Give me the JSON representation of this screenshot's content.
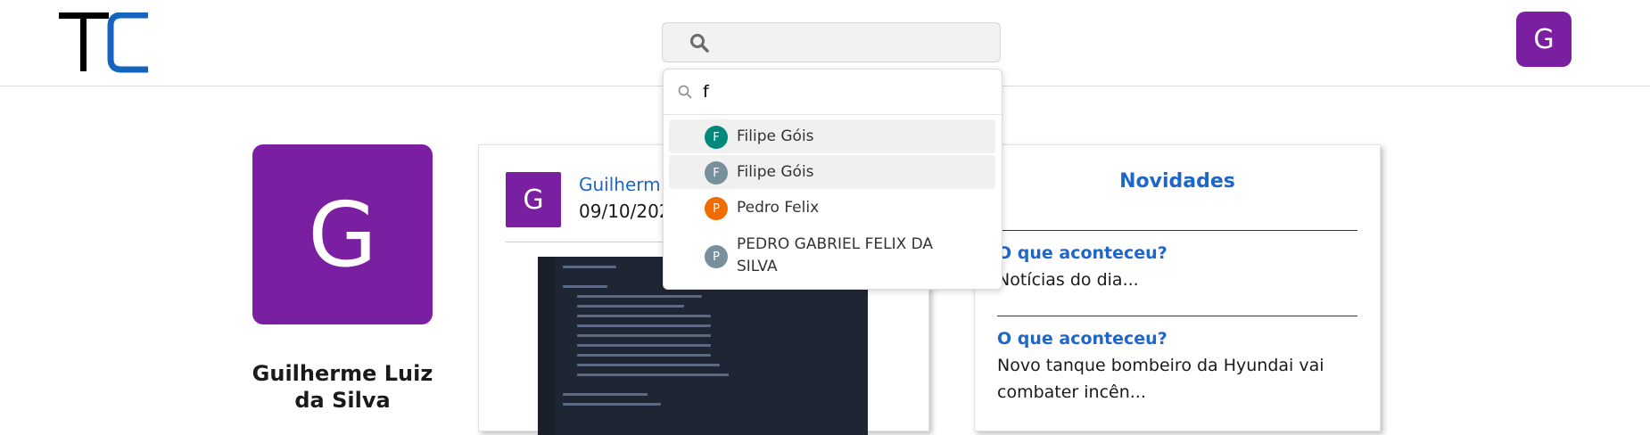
{
  "header": {
    "logo_text": "TC",
    "user_initial": "G"
  },
  "profile": {
    "initial": "G",
    "name": "Guilherme Luiz da Silva"
  },
  "post": {
    "author_initial": "G",
    "author_visible": "Guilherm",
    "date_visible": "09/10/202"
  },
  "news": {
    "title": "Novidades",
    "items": [
      {
        "heading": "O que aconteceu?",
        "body": "Notícias do dia..."
      },
      {
        "heading": "O que aconteceu?",
        "body": "Novo tanque bombeiro da Hyundai vai combater incên..."
      }
    ]
  },
  "search_dropdown": {
    "query": "f",
    "results": [
      {
        "initial": "F",
        "name": "Filipe Góis",
        "color": "#00897b"
      },
      {
        "initial": "F",
        "name": "Filipe Góis",
        "color": "#78909c"
      },
      {
        "initial": "P",
        "name": "Pedro Felix",
        "color": "#ef6c00"
      },
      {
        "initial": "P",
        "name": "PEDRO GABRIEL FELIX DA SILVA",
        "color": "#78909c"
      }
    ]
  },
  "colors": {
    "brand_purple": "#7b1fa2",
    "link_blue": "#1e66c9",
    "logo_blue": "#1565c0"
  }
}
